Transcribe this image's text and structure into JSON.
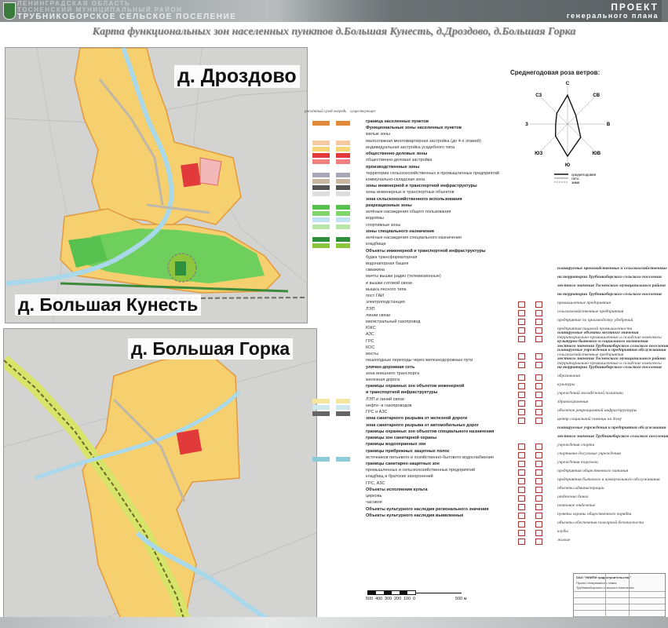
{
  "header": {
    "org_line1": "ЛЕНИНГРАДСКАЯ ОБЛАСТЬ",
    "org_line2": "ТОСНЕНСКИЙ МУНИЦИПАЛЬНЫЙ РАЙОН",
    "org_line3": "ТРУБНИКОБОРСКОЕ СЕЛЬСКОЕ ПОСЕЛЕНИЕ",
    "project_line1": "ПРОЕКТ",
    "project_line2": "генерального плана"
  },
  "title": "Карта функциональных зон населенных пунктов д.Большая Кунесть, д.Дроздово, д.Большая Горка",
  "maps": {
    "drozdovo": "д. Дроздово",
    "kunest": "д. Большая Кунесть",
    "gorka": "д. Большая Горка"
  },
  "wind_rose": {
    "title": "Среднегодовая роза ветров:",
    "directions": [
      "С",
      "СВ",
      "В",
      "ЮВ",
      "Ю",
      "ЮЗ",
      "З",
      "СЗ"
    ],
    "values": [
      0.85,
      0.35,
      0.3,
      0.55,
      0.95,
      0.5,
      0.35,
      0.45
    ],
    "legend": [
      "среднегодовая",
      "лето",
      "зима"
    ]
  },
  "legend": {
    "col1": "расчётный срок",
    "col2": "I очередь",
    "col3": "существующее",
    "items": [
      {
        "text": "граница населенных пунктов",
        "bold": true,
        "color": "#e08a3a"
      },
      {
        "text": "Функциональные зоны населенных пунктов",
        "bold": true,
        "color": ""
      },
      {
        "text": "жилые зоны",
        "bold": false,
        "color": ""
      },
      {
        "text": "малоэтажная многоквартирная застройка (до 4-х этажей)",
        "bold": false,
        "color": "#f6c9a0"
      },
      {
        "text": "индивидуальная застройка усадебного типа",
        "bold": false,
        "color": "#f7d67a"
      },
      {
        "text": "общественно-деловые зоны",
        "bold": true,
        "color": "#e23a3a"
      },
      {
        "text": "общественно-деловая застройка",
        "bold": false,
        "color": "#f08080"
      },
      {
        "text": "производственные зоны",
        "bold": true,
        "color": ""
      },
      {
        "text": "территории сельскохозяйственных и промышленных предприятий",
        "bold": false,
        "color": "#a9a6b8"
      },
      {
        "text": "коммунально-складская зона",
        "bold": false,
        "color": "#c7b6a0"
      },
      {
        "text": "зоны инженерной и транспортной инфраструктуры",
        "bold": true,
        "color": "#555555"
      },
      {
        "text": "зоны инженерных и транспортных объектов",
        "bold": false,
        "color": "#dedede"
      },
      {
        "text": "зона сельскохозяйственного использования",
        "bold": true,
        "color": ""
      },
      {
        "text": "рекреационные зоны",
        "bold": true,
        "color": "#56c14e"
      },
      {
        "text": "зелёные насаждения общего пользования",
        "bold": false,
        "color": "#7fd46b"
      },
      {
        "text": "водоёмы",
        "bold": false,
        "color": "#bfe3f2"
      },
      {
        "text": "спортивные зоны",
        "bold": false,
        "color": "#b9e6a8"
      },
      {
        "text": "зоны специального назначения",
        "bold": true,
        "color": ""
      },
      {
        "text": "зелёные насаждения специального назначения",
        "bold": false,
        "color": "#2f8f3a"
      },
      {
        "text": "кладбище",
        "bold": false,
        "color": "#8cc63f"
      },
      {
        "text": "Объекты инженерной и транспортной инфраструктуры",
        "bold": true,
        "color": ""
      },
      {
        "text": "будка трансформаторная",
        "bold": false,
        "color": ""
      },
      {
        "text": "водонапорная башня",
        "bold": false,
        "color": ""
      },
      {
        "text": "скважина",
        "bold": false,
        "color": ""
      },
      {
        "text": "мачты вышки радио (телевизионные)",
        "bold": false,
        "color": ""
      },
      {
        "text": "и вышки сотовой связи",
        "bold": false,
        "color": ""
      },
      {
        "text": "вышка лесного типа",
        "bold": false,
        "color": ""
      },
      {
        "text": "пост ГАИ",
        "bold": false,
        "color": ""
      },
      {
        "text": "электроподстанция",
        "bold": false,
        "color": ""
      },
      {
        "text": "ЛЭП",
        "bold": false,
        "color": ""
      },
      {
        "text": "линии связи",
        "bold": false,
        "color": ""
      },
      {
        "text": "магистральный газопровод",
        "bold": false,
        "color": ""
      },
      {
        "text": "ЮКС",
        "bold": false,
        "color": ""
      },
      {
        "text": "АЗС",
        "bold": false,
        "color": ""
      },
      {
        "text": "ГРС",
        "bold": false,
        "color": ""
      },
      {
        "text": "КОС",
        "bold": false,
        "color": ""
      },
      {
        "text": "мосты",
        "bold": false,
        "color": ""
      },
      {
        "text": "пешеходные переходы через железнодорожные пути",
        "bold": false,
        "color": ""
      },
      {
        "text": "улично-дорожная сеть",
        "bold": true,
        "color": ""
      },
      {
        "text": "зона внешнего транспорта",
        "bold": false,
        "color": ""
      },
      {
        "text": "железная дорога",
        "bold": false,
        "color": ""
      },
      {
        "text": "границы охранных зон объектов инженерной",
        "bold": true,
        "color": ""
      },
      {
        "text": "и транспортной инфраструктуры",
        "bold": true,
        "color": ""
      },
      {
        "text": "ЛЭП и линий связи",
        "bold": false,
        "color": "#f6e7a0"
      },
      {
        "text": "нефте- и газопроводов",
        "bold": false,
        "color": "#cfe7ef"
      },
      {
        "text": "ГРС и АЗС",
        "bold": false,
        "color": "#666666"
      },
      {
        "text": "зона санитарного разрыва от железной дороги",
        "bold": true,
        "color": ""
      },
      {
        "text": "зона санитарного разрыва от автомобильных дорог",
        "bold": true,
        "color": ""
      },
      {
        "text": "границы охранных зон объектов специального назначения",
        "bold": true,
        "color": ""
      },
      {
        "text": "границы зон санитарной охраны",
        "bold": true,
        "color": ""
      },
      {
        "text": "границы водоохранных зон",
        "bold": true,
        "color": ""
      },
      {
        "text": "границы прибрежных защитных полос",
        "bold": true,
        "color": ""
      },
      {
        "text": "источников питьевого и хозяйственно-бытового водоснабжения",
        "bold": false,
        "color": "#8ecbd8"
      },
      {
        "text": "границы санитарно-защитных зон",
        "bold": true,
        "color": ""
      },
      {
        "text": "промышленных и сельскохозяйственных предприятий",
        "bold": false,
        "color": ""
      },
      {
        "text": "кладбищ и братских захоронений",
        "bold": false,
        "color": ""
      },
      {
        "text": "ГРС, АЗС",
        "bold": false,
        "color": ""
      },
      {
        "text": "Объекты исполнения культа",
        "bold": true,
        "color": ""
      },
      {
        "text": "церковь",
        "bold": false,
        "color": ""
      },
      {
        "text": "часовня",
        "bold": false,
        "color": ""
      },
      {
        "text": "Объекты культурного наследия регионального значения",
        "bold": true,
        "color": ""
      },
      {
        "text": "Объекты культурного наследия выявленные",
        "bold": true,
        "color": ""
      }
    ]
  },
  "side_legend": {
    "block1": [
      {
        "text": "планируемые производственные и сельскохозяйственные объекты",
        "bold": true
      },
      {
        "text": "на территории Трубникоборского сельского поселения",
        "bold": true
      },
      {
        "text": "местного значения Тосненского муниципального района",
        "bold": true
      },
      {
        "text": "на территории Трубникоборского сельского поселения",
        "bold": true
      },
      {
        "text": "промышленные предприятия",
        "bold": false
      },
      {
        "text": "сельскохозяйственные предприятия",
        "bold": false
      },
      {
        "text": "предприятие по производству удобрений",
        "bold": false
      },
      {
        "text": "предприятия пищевой промышленности",
        "bold": false
      },
      {
        "text": "территориально-промышленные и складские комплексы",
        "bold": false
      },
      {
        "text": "местного значения Трубникоборского сельского поселения",
        "bold": true
      },
      {
        "text": "сельскохозяйственные предприятия",
        "bold": false
      },
      {
        "text": "территориально-промышленные и складские комплексы",
        "bold": false
      }
    ],
    "block2": [
      {
        "text": "планируемые объекты местного значения",
        "bold": true
      },
      {
        "text": "культурно-бытового и социального назначения",
        "bold": true
      },
      {
        "text": "планируемые учреждения и предприятия обслуживания",
        "bold": true
      },
      {
        "text": "местного значения Тосненского муниципального района",
        "bold": true
      },
      {
        "text": "на территории Трубникоборского сельского поселения",
        "bold": true
      },
      {
        "text": "образования",
        "bold": false
      },
      {
        "text": "культуры",
        "bold": false
      },
      {
        "text": "учреждений молодёжной политики",
        "bold": false
      },
      {
        "text": "здравоохранения",
        "bold": false
      },
      {
        "text": "объектов рекреационной инфраструктуры",
        "bold": false
      },
      {
        "text": "центр социальной помощи на дому",
        "bold": false
      },
      {
        "text": "планируемые учреждения и предприятия обслуживания",
        "bold": true
      },
      {
        "text": "местного значения Трубникоборского сельского поселения",
        "bold": true
      },
      {
        "text": "учреждения спорта",
        "bold": false
      },
      {
        "text": "спортивно-досуговые учреждения",
        "bold": false
      },
      {
        "text": "учреждения торговли",
        "bold": false
      },
      {
        "text": "предприятия общественного питания",
        "bold": false
      },
      {
        "text": "предприятия бытового и коммунального обслуживания",
        "bold": false
      },
      {
        "text": "объекты администрации",
        "bold": false
      },
      {
        "text": "отделение банка",
        "bold": false
      },
      {
        "text": "почтовое отделение",
        "bold": false
      },
      {
        "text": "пункты охраны общественного порядка",
        "bold": false
      },
      {
        "text": "объекты обеспечения пожарной безопасности",
        "bold": false
      },
      {
        "text": "клубы",
        "bold": false
      },
      {
        "text": "жилые",
        "bold": false
      }
    ]
  },
  "scale": {
    "ticks": [
      "500",
      "400",
      "300",
      "200",
      "100",
      "0"
    ],
    "end": "500 м"
  },
  "stamp": {
    "org": "ОАО \"НИИПИ градостроительства\"",
    "l1": "Проект генерального плана",
    "l2": "Трубникоборского сельского поселения"
  }
}
